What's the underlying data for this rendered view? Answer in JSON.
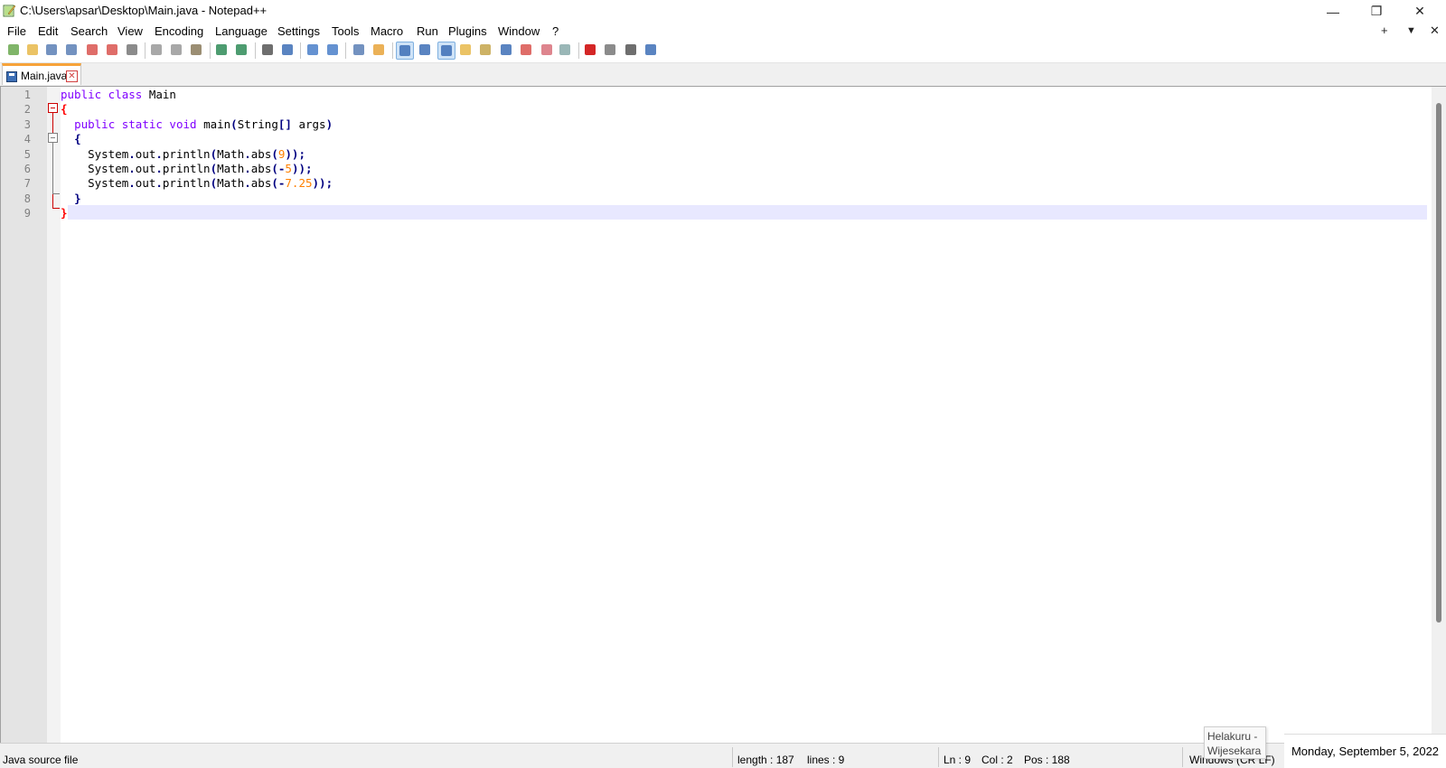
{
  "window": {
    "title": "C:\\Users\\apsar\\Desktop\\Main.java - Notepad++",
    "icon": "notepadpp-icon",
    "controls": {
      "minimize": "—",
      "restore": "❐",
      "close": "✕"
    }
  },
  "menu": {
    "items": [
      "File",
      "Edit",
      "Search",
      "View",
      "Encoding",
      "Language",
      "Settings",
      "Tools",
      "Macro",
      "Run",
      "Plugins",
      "Window",
      "?"
    ],
    "right": {
      "add": "+",
      "list": "▼",
      "close": "✕"
    }
  },
  "toolbar": {
    "buttons": [
      "new-file-icon",
      "open-file-icon",
      "save-icon",
      "save-all-icon",
      "close-icon",
      "close-all-icon",
      "print-icon",
      "cut-icon",
      "copy-icon",
      "paste-icon",
      "undo-icon",
      "redo-icon",
      "find-icon",
      "replace-icon",
      "zoom-in-icon",
      "zoom-out-icon",
      "sync-vertical-icon",
      "sync-horizontal-icon",
      "word-wrap-icon",
      "show-all-chars-icon",
      "indent-guide-icon",
      "user-language-icon",
      "document-map-icon",
      "function-list-icon",
      "folder-workspace-icon",
      "monitoring-icon",
      "record-macro-icon",
      "stop-macro-icon",
      "play-macro-icon",
      "run-macro-multiple-icon",
      "save-macro-icon"
    ]
  },
  "tab": {
    "label": "Main.java",
    "close": "✕"
  },
  "editor": {
    "line_numbers": [
      "1",
      "2",
      "3",
      "4",
      "5",
      "6",
      "7",
      "8",
      "9"
    ],
    "lines": [
      [
        {
          "t": "public class ",
          "c": "kw"
        },
        {
          "t": "Main",
          "c": ""
        }
      ],
      [
        {
          "t": "{",
          "c": "brace-red"
        }
      ],
      [
        {
          "t": "  ",
          "c": ""
        },
        {
          "t": "public static void ",
          "c": "kw"
        },
        {
          "t": "main",
          "c": ""
        },
        {
          "t": "(",
          "c": "op"
        },
        {
          "t": "String",
          "c": ""
        },
        {
          "t": "[]",
          "c": "op"
        },
        {
          "t": " args",
          "c": ""
        },
        {
          "t": ")",
          "c": "op"
        }
      ],
      [
        {
          "t": "  ",
          "c": ""
        },
        {
          "t": "{",
          "c": "op"
        }
      ],
      [
        {
          "t": "    System",
          "c": ""
        },
        {
          "t": ".",
          "c": "op"
        },
        {
          "t": "out",
          "c": ""
        },
        {
          "t": ".",
          "c": "op"
        },
        {
          "t": "println",
          "c": ""
        },
        {
          "t": "(",
          "c": "op"
        },
        {
          "t": "Math",
          "c": ""
        },
        {
          "t": ".",
          "c": "op"
        },
        {
          "t": "abs",
          "c": ""
        },
        {
          "t": "(",
          "c": "op"
        },
        {
          "t": "9",
          "c": "num"
        },
        {
          "t": "));",
          "c": "op"
        }
      ],
      [
        {
          "t": "    System",
          "c": ""
        },
        {
          "t": ".",
          "c": "op"
        },
        {
          "t": "out",
          "c": ""
        },
        {
          "t": ".",
          "c": "op"
        },
        {
          "t": "println",
          "c": ""
        },
        {
          "t": "(",
          "c": "op"
        },
        {
          "t": "Math",
          "c": ""
        },
        {
          "t": ".",
          "c": "op"
        },
        {
          "t": "abs",
          "c": ""
        },
        {
          "t": "(-",
          "c": "op"
        },
        {
          "t": "5",
          "c": "num"
        },
        {
          "t": "));",
          "c": "op"
        }
      ],
      [
        {
          "t": "    System",
          "c": ""
        },
        {
          "t": ".",
          "c": "op"
        },
        {
          "t": "out",
          "c": ""
        },
        {
          "t": ".",
          "c": "op"
        },
        {
          "t": "println",
          "c": ""
        },
        {
          "t": "(",
          "c": "op"
        },
        {
          "t": "Math",
          "c": ""
        },
        {
          "t": ".",
          "c": "op"
        },
        {
          "t": "abs",
          "c": ""
        },
        {
          "t": "(-",
          "c": "op"
        },
        {
          "t": "7.25",
          "c": "num"
        },
        {
          "t": "));",
          "c": "op"
        }
      ],
      [
        {
          "t": "  ",
          "c": ""
        },
        {
          "t": "}",
          "c": "op"
        }
      ],
      [
        {
          "t": "}",
          "c": "brace-red"
        }
      ]
    ]
  },
  "status": {
    "file_type": "Java source file",
    "length": "length : 187",
    "lines": "lines : 9",
    "ln": "Ln : 9",
    "col": "Col : 2",
    "pos": "Pos : 188",
    "eol": "Windows (CR LF)"
  },
  "taskbar": {
    "tooltip": "Helakuru - Wijesekara",
    "clock": "Monday, September 5, 2022"
  },
  "colors": {
    "keyword": "#8000ff",
    "number": "#ff8000",
    "operator": "#000080",
    "current_line": "#e8e8ff",
    "tab_accent": "#f7a33a"
  }
}
